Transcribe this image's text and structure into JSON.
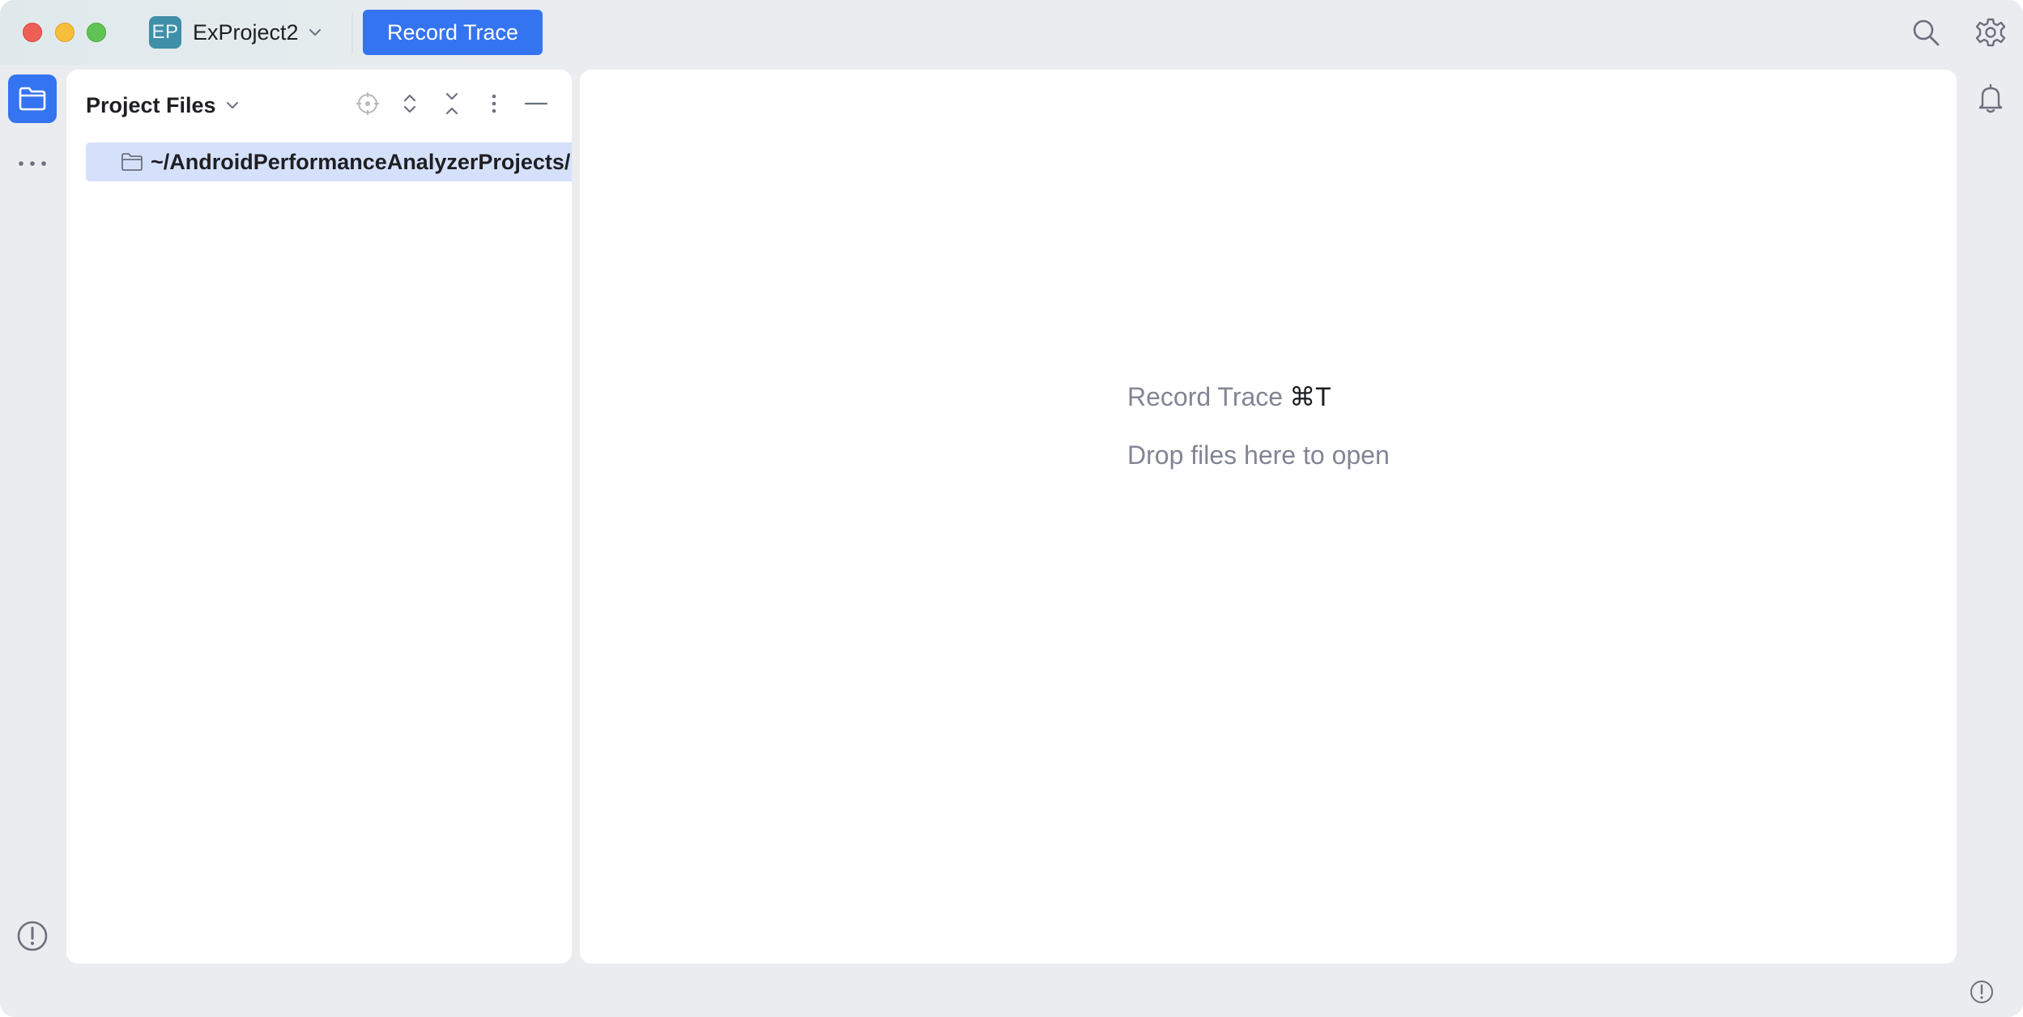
{
  "window": {
    "traffic_lights": [
      "close",
      "minimize",
      "maximize"
    ]
  },
  "titlebar": {
    "project_badge": "EP",
    "project_name": "ExProject2",
    "record_button_label": "Record Trace",
    "icons": [
      "search-icon",
      "settings-gear-icon"
    ]
  },
  "tool_strip": {
    "items": [
      "project-files-folder-icon",
      "more-dots-icon",
      "problems-warning-icon"
    ]
  },
  "project_panel": {
    "title": "Project Files",
    "toolbar_icons": [
      "locate-icon",
      "expand-all-icon",
      "collapse-all-icon",
      "options-menu-icon",
      "hide-minus-icon"
    ],
    "tree": [
      {
        "label": "~/AndroidPerformanceAnalyzerProjects/",
        "icon": "folder-icon",
        "selected": true
      }
    ]
  },
  "editor": {
    "hint_action": "Record Trace",
    "hint_shortcut": "⌘T",
    "hint_drop": "Drop files here to open"
  },
  "right_strip": {
    "items": [
      "notifications-bell-icon"
    ]
  },
  "status_bar": {
    "items": [
      "status-warning-icon"
    ]
  },
  "colors": {
    "accent": "#3574f0",
    "window_bg": "#ebecf0",
    "selection": "#d5e1fb",
    "hint_text": "#818594",
    "project_badge": "#3f8fa8"
  }
}
